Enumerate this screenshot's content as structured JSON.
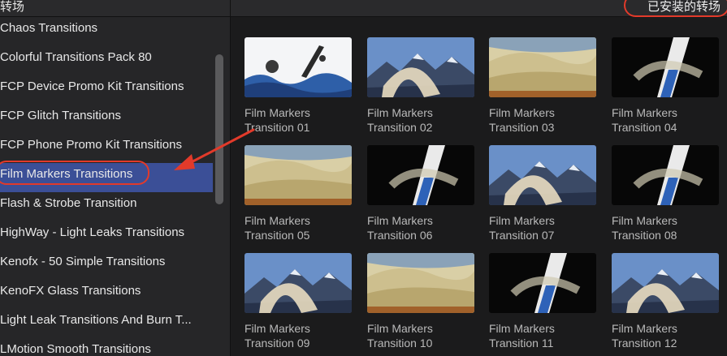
{
  "header": {
    "left_title": "转场",
    "right_title": "已安装的转场"
  },
  "sidebar": {
    "items": [
      {
        "label": "Chaos Transitions"
      },
      {
        "label": "Colorful Transitions Pack 80"
      },
      {
        "label": "FCP Device Promo Kit Transitions"
      },
      {
        "label": "FCP Glitch Transitions"
      },
      {
        "label": "FCP Phone Promo Kit Transitions"
      },
      {
        "label": "Film Markers Transitions",
        "selected": true
      },
      {
        "label": "Flash & Strobe Transition"
      },
      {
        "label": "HighWay - Light Leaks Transitions"
      },
      {
        "label": "Kenofx - 50 Simple Transitions"
      },
      {
        "label": "KenoFX Glass Transitions"
      },
      {
        "label": "Light Leak Transitions And Burn T..."
      },
      {
        "label": "LMotion Smooth Transitions"
      }
    ]
  },
  "transitions": [
    {
      "line1": "Film Markers",
      "line2": "Transition 01",
      "style": "sky"
    },
    {
      "line1": "Film Markers",
      "line2": "Transition 02",
      "style": "mountain"
    },
    {
      "line1": "Film Markers",
      "line2": "Transition 03",
      "style": "sand"
    },
    {
      "line1": "Film Markers",
      "line2": "Transition 04",
      "style": "dark"
    },
    {
      "line1": "Film Markers",
      "line2": "Transition 05",
      "style": "sand"
    },
    {
      "line1": "Film Markers",
      "line2": "Transition 06",
      "style": "dark"
    },
    {
      "line1": "Film Markers",
      "line2": "Transition 07",
      "style": "mountain"
    },
    {
      "line1": "Film Markers",
      "line2": "Transition 08",
      "style": "dark"
    },
    {
      "line1": "Film Markers",
      "line2": "Transition 09",
      "style": "mountain"
    },
    {
      "line1": "Film Markers",
      "line2": "Transition 10",
      "style": "sand"
    },
    {
      "line1": "Film Markers",
      "line2": "Transition 11",
      "style": "dark"
    },
    {
      "line1": "Film Markers",
      "line2": "Transition 12",
      "style": "mountain"
    }
  ],
  "colors": {
    "selection": "#3b4f97",
    "annotation": "#e23a2a"
  }
}
